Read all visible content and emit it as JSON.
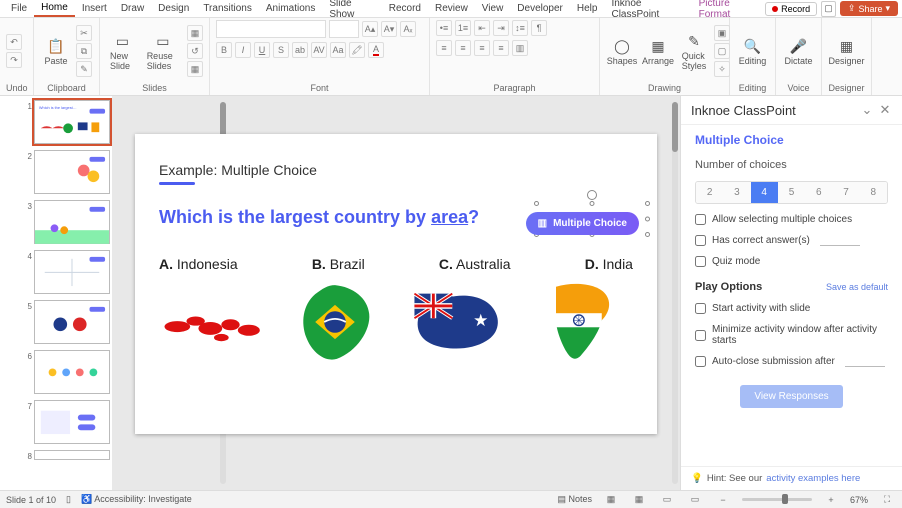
{
  "menu": {
    "tabs": [
      "File",
      "Home",
      "Insert",
      "Draw",
      "Design",
      "Transitions",
      "Animations",
      "Slide Show",
      "Record",
      "Review",
      "View",
      "Developer",
      "Help",
      "Inknoe ClassPoint"
    ],
    "contextual": "Picture Format",
    "active": "Home",
    "record": "Record",
    "share": "Share"
  },
  "ribbon": {
    "undo": "Undo",
    "clipboard": "Clipboard",
    "paste": "Paste",
    "slides": "Slides",
    "new_slide": "New Slide",
    "reuse": "Reuse Slides",
    "font": "Font",
    "paragraph": "Paragraph",
    "drawing": "Drawing",
    "shapes": "Shapes",
    "arrange": "Arrange",
    "quick": "Quick Styles",
    "editing": "Editing",
    "voice": "Voice",
    "dictate": "Dictate",
    "designer": "Designer",
    "designer_lbl": "Designer"
  },
  "slide": {
    "heading": "Example: Multiple Choice",
    "question_a": "Which is the largest country by ",
    "question_u": "area",
    "question_b": "?",
    "mc_button": "Multiple Choice",
    "opt_a_l": "A.",
    "opt_a_t": "Indonesia",
    "opt_b_l": "B.",
    "opt_b_t": "Brazil",
    "opt_c_l": "C.",
    "opt_c_t": "Australia",
    "opt_d_l": "D.",
    "opt_d_t": "India"
  },
  "panel": {
    "title": "Inknoe ClassPoint",
    "subtitle": "Multiple Choice",
    "num_label": "Number of choices",
    "choices": [
      "2",
      "3",
      "4",
      "5",
      "6",
      "7",
      "8"
    ],
    "choice_active": "4",
    "chk1": "Allow selecting multiple choices",
    "chk2": "Has correct answer(s)",
    "chk3": "Quiz mode",
    "play_title": "Play Options",
    "save_default": "Save as default",
    "chk4": "Start activity with slide",
    "chk5": "Minimize activity window after activity starts",
    "chk6": "Auto-close submission after",
    "view_btn": "View Responses",
    "hint_a": "Hint: See our ",
    "hint_b": "activity examples here"
  },
  "status": {
    "slide": "Slide 1 of 10",
    "acc": "Accessibility: Investigate",
    "notes": "Notes",
    "zoom": "67%"
  }
}
